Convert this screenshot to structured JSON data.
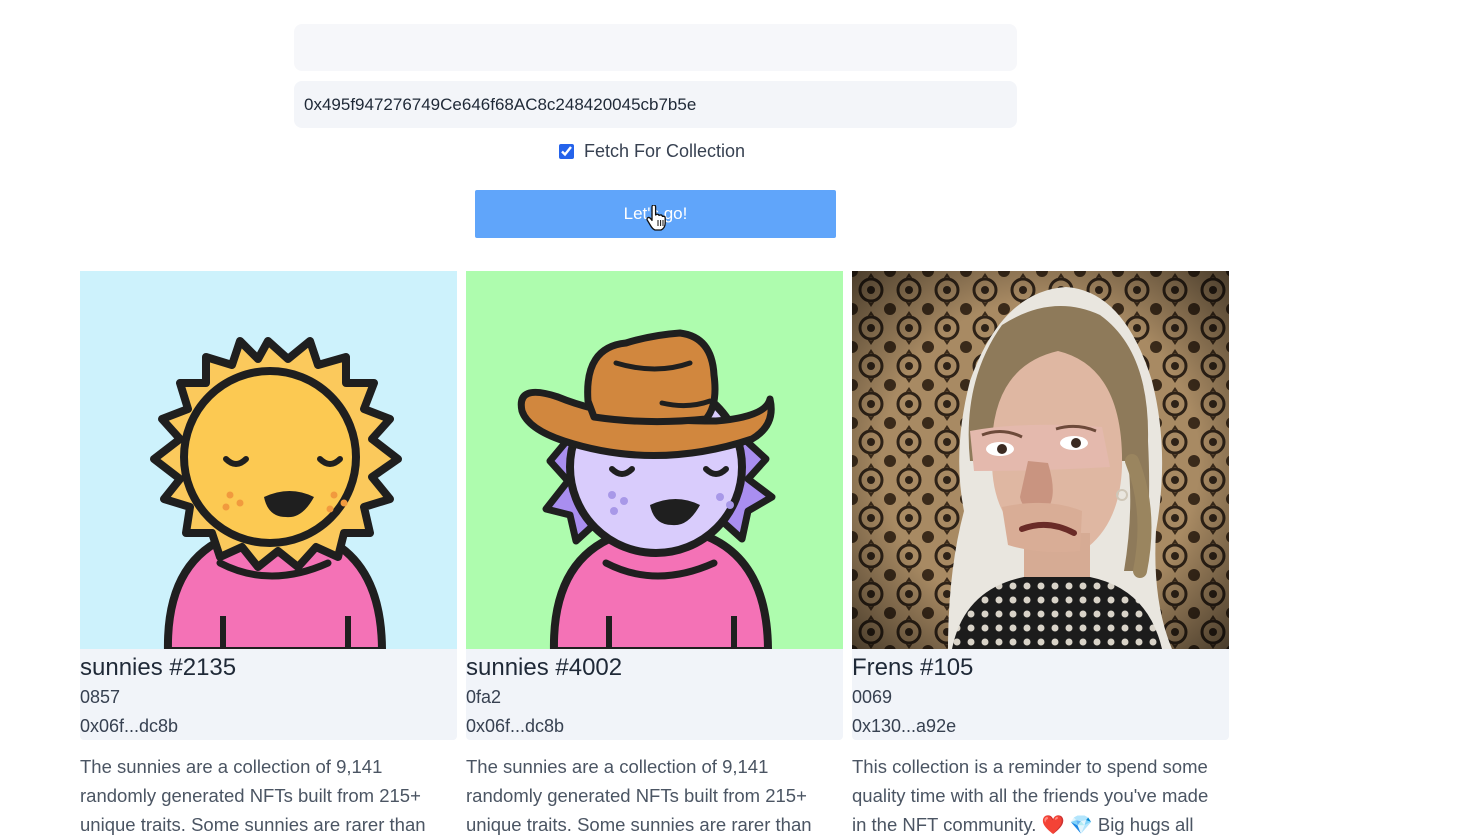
{
  "form": {
    "wallet_value": "",
    "contract_value": "0x495f947276749Ce646f68AC8c248420045cb7b5e",
    "fetch_label": "Fetch For Collection",
    "fetch_checked": true,
    "submit_label": "Let's go!"
  },
  "cards": [
    {
      "title": "sunnies #2135",
      "token_id": "0857",
      "owner": "0x06f...dc8b",
      "description": "The sunnies are a collection of 9,141 randomly generated NFTs built from 215+ unique traits. Some sunnies are rarer than",
      "bg_color": "#cdf2fc",
      "image": "sun-character"
    },
    {
      "title": "sunnies #4002",
      "token_id": "0fa2",
      "owner": "0x06f...dc8b",
      "description": "The sunnies are a collection of 9,141 randomly generated NFTs built from 215+ unique traits. Some sunnies are rarer than",
      "bg_color": "#aefcae",
      "image": "cowboy-character"
    },
    {
      "title": "Frens #105",
      "token_id": "0069",
      "owner": "0x130...a92e",
      "description": "This collection is a reminder to spend some quality time with all the friends you've made in the NFT community. ❤️ 💎 Big hugs all",
      "bg_color": "#5b4632",
      "image": "collage-portrait"
    }
  ],
  "colors": {
    "button": "#60a5fa",
    "meta_bg": "#f1f4f9",
    "input_bg": "#f3f5f9"
  }
}
